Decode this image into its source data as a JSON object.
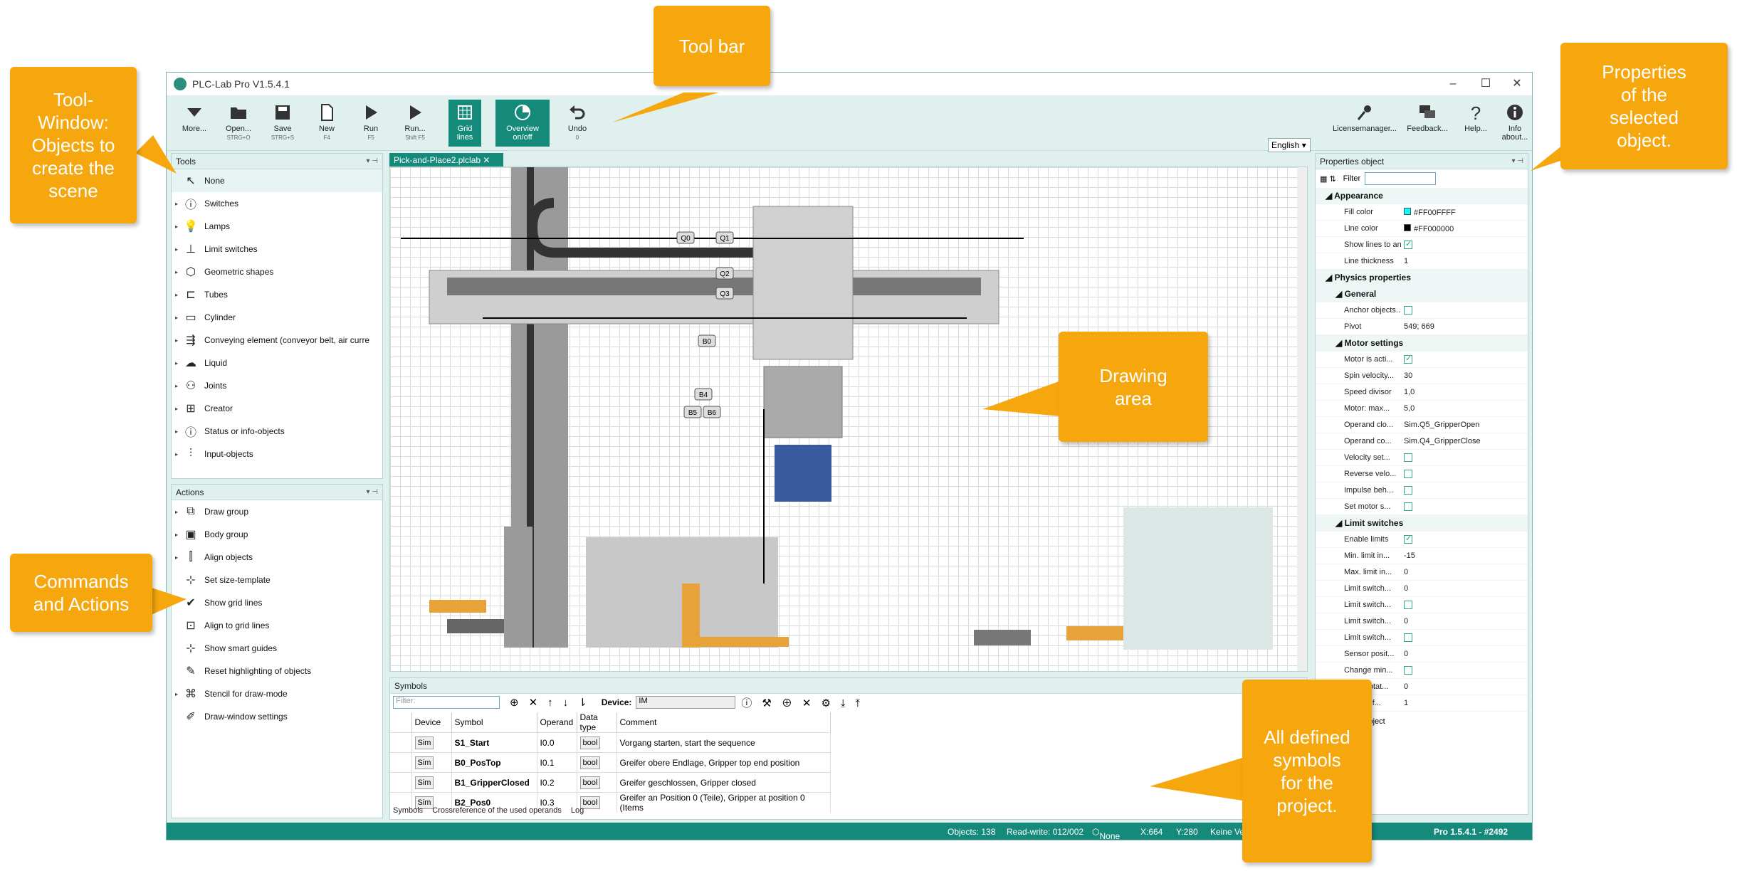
{
  "app": {
    "title": "PLC-Lab Pro V1.5.4.1",
    "language": "English"
  },
  "toolbar": [
    {
      "label": "More...",
      "shortcut": ""
    },
    {
      "label": "Open...",
      "shortcut": "STRG+O"
    },
    {
      "label": "Save",
      "shortcut": "STRG+S"
    },
    {
      "label": "New",
      "shortcut": "F4"
    },
    {
      "label": "Run",
      "shortcut": "F5"
    },
    {
      "label": "Run...",
      "shortcut": "Shift F5"
    },
    {
      "label": "Grid lines",
      "shortcut": ""
    },
    {
      "label": "Overview on/off",
      "shortcut": ""
    },
    {
      "label": "Undo",
      "shortcut": "0"
    }
  ],
  "toolbar_right": [
    {
      "label": "Licensemanager..."
    },
    {
      "label": "Feedback..."
    },
    {
      "label": "Help..."
    },
    {
      "label": "Info about..."
    }
  ],
  "tools_panel": {
    "title": "Tools",
    "items": [
      "None",
      "Switches",
      "Lamps",
      "Limit switches",
      "Geometric shapes",
      "Tubes",
      "Cylinder",
      "Conveying element (conveyor belt, air curre",
      "Liquid",
      "Joints",
      "Creator",
      "Status or info-objects",
      "Input-objects"
    ]
  },
  "actions_panel": {
    "title": "Actions",
    "items": [
      "Draw group",
      "Body group",
      "Align objects",
      "Set size-template",
      "Show grid lines",
      "Align to grid lines",
      "Show smart guides",
      "Reset highlighting of objects",
      "Stencil for draw-mode",
      "Draw-window settings"
    ]
  },
  "document_tab": "Pick-and-Place2.plclab",
  "drawing_labels": [
    "Q0",
    "Q1",
    "Q2",
    "Q3",
    "B0",
    "B4",
    "B5",
    "B6"
  ],
  "properties": {
    "title": "Properties object",
    "filter_label": "Filter",
    "appearance": {
      "title": "Appearance",
      "fill_color_label": "Fill color",
      "fill_color": "#FF00FFFF",
      "line_color_label": "Line color",
      "line_color": "#FF000000",
      "show_lines_label": "Show lines to anc...",
      "line_thickness_label": "Line thickness",
      "line_thickness": "1"
    },
    "physics_title": "Physics properties",
    "general_title": "General",
    "anchor_label": "Anchor objects...",
    "pivot_label": "Pivot",
    "pivot": "549; 669",
    "motor_title": "Motor settings",
    "motor_rows": [
      {
        "k": "Motor is acti...",
        "v": "check"
      },
      {
        "k": "Spin velocity...",
        "v": "30"
      },
      {
        "k": "Speed divisor",
        "v": "1,0"
      },
      {
        "k": "Motor: max...",
        "v": "5,0"
      },
      {
        "k": "Operand clo...",
        "v": "Sim.Q5_GripperOpen"
      },
      {
        "k": "Operand co...",
        "v": "Sim.Q4_GripperClose"
      },
      {
        "k": "Velocity set...",
        "v": "box"
      },
      {
        "k": "Reverse velo...",
        "v": "box"
      },
      {
        "k": "Impulse beh...",
        "v": "box"
      },
      {
        "k": "Set motor s...",
        "v": "box"
      }
    ],
    "limit_title": "Limit switches",
    "limit_rows": [
      {
        "k": "Enable limits",
        "v": "check"
      },
      {
        "k": "Min. limit in...",
        "v": "-15"
      },
      {
        "k": "Max. limit in...",
        "v": "0"
      },
      {
        "k": "Limit switch...",
        "v": "0"
      },
      {
        "k": "Limit switch...",
        "v": "box"
      },
      {
        "k": "Limit switch...",
        "v": "0"
      },
      {
        "k": "Limit switch...",
        "v": "box"
      },
      {
        "k": "Sensor posit...",
        "v": "0"
      },
      {
        "k": "Change min...",
        "v": "box"
      },
      {
        "k": "Motor rotat...",
        "v": "0"
      },
      {
        "k": "...factor f...",
        "v": "1"
      }
    ],
    "footer": "the object"
  },
  "symbols": {
    "title": "Symbols",
    "filter_placeholder": "Filter:",
    "device_label": "Device:",
    "device_value": "IM",
    "columns": [
      "Device",
      "Symbol",
      "Operand",
      "Data type",
      "Comment"
    ],
    "rows": [
      {
        "device": "Sim",
        "symbol": "S1_Start",
        "operand": "I0.0",
        "type": "bool",
        "comment": "Vorgang starten, start the sequence"
      },
      {
        "device": "Sim",
        "symbol": "B0_PosTop",
        "operand": "I0.1",
        "type": "bool",
        "comment": "Greifer obere Endlage, Gripper top end position"
      },
      {
        "device": "Sim",
        "symbol": "B1_GripperClosed",
        "operand": "I0.2",
        "type": "bool",
        "comment": "Greifer geschlossen, Gripper closed"
      },
      {
        "device": "Sim",
        "symbol": "B2_Pos0",
        "operand": "I0.3",
        "type": "bool",
        "comment": "Greifer an Position 0 (Teile), Gripper at position 0 (Items"
      }
    ],
    "tabs": [
      "Symbols",
      "Crossreference of the used operands",
      "Log"
    ]
  },
  "status": {
    "objects": "Objects: 138",
    "readwrite": "Read-write: 012/002",
    "none": "None",
    "x": "X:664",
    "y": "Y:280",
    "keine": "Keine Verl",
    "version": "Pro 1.5.4.1 - #2492"
  },
  "callouts": {
    "toolbar": [
      "Tool bar"
    ],
    "toolwindow": [
      "Tool-",
      "Window:",
      "Objects to",
      "create the",
      "scene"
    ],
    "properties": [
      "Properties",
      "of the",
      "selected",
      "object."
    ],
    "drawing": [
      "Drawing",
      "area"
    ],
    "commands": [
      "Commands",
      "and Actions"
    ],
    "symbols": [
      "All defined",
      "symbols",
      "for the",
      "project."
    ]
  },
  "colors": {
    "accent": "#168a7a",
    "callout": "#f6a70e",
    "panel_bg": "#dff0ef"
  }
}
